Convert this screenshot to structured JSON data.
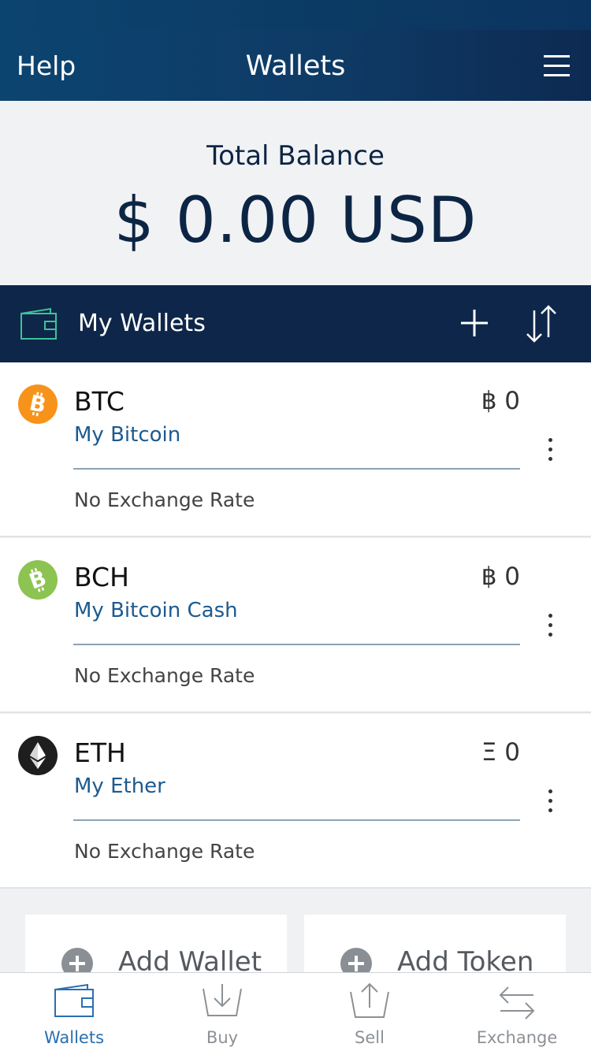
{
  "header": {
    "help_label": "Help",
    "title": "Wallets",
    "menu_icon": "hamburger-menu-icon"
  },
  "balance": {
    "label": "Total Balance",
    "amount": "$ 0.00 USD"
  },
  "my_wallets": {
    "label": "My Wallets",
    "icons": [
      "wallet-icon",
      "plus-icon",
      "sort-arrows-icon"
    ]
  },
  "wallets": [
    {
      "code": "BTC",
      "name": "My Bitcoin",
      "balance": "฿ 0",
      "rate": "No Exchange Rate",
      "icon": "bitcoin-icon",
      "color": "#f7931a"
    },
    {
      "code": "BCH",
      "name": "My Bitcoin Cash",
      "balance": "฿ 0",
      "rate": "No Exchange Rate",
      "icon": "bitcoin-cash-icon",
      "color": "#8dc351"
    },
    {
      "code": "ETH",
      "name": "My Ether",
      "balance": "Ξ 0",
      "rate": "No Exchange Rate",
      "icon": "ethereum-icon",
      "color": "#1e1e1e"
    }
  ],
  "actions": {
    "add_wallet": "Add Wallet",
    "add_token": "Add Token"
  },
  "tabs": [
    {
      "label": "Wallets",
      "icon": "wallet-icon",
      "active": true
    },
    {
      "label": "Buy",
      "icon": "buy-icon",
      "active": false
    },
    {
      "label": "Sell",
      "icon": "sell-icon",
      "active": false
    },
    {
      "label": "Exchange",
      "icon": "exchange-icon",
      "active": false
    }
  ],
  "colors": {
    "header": "#0c4470",
    "navy": "#0e2649",
    "accent": "#2a6fb0",
    "wallet_icon_green": "#3ec29a"
  }
}
